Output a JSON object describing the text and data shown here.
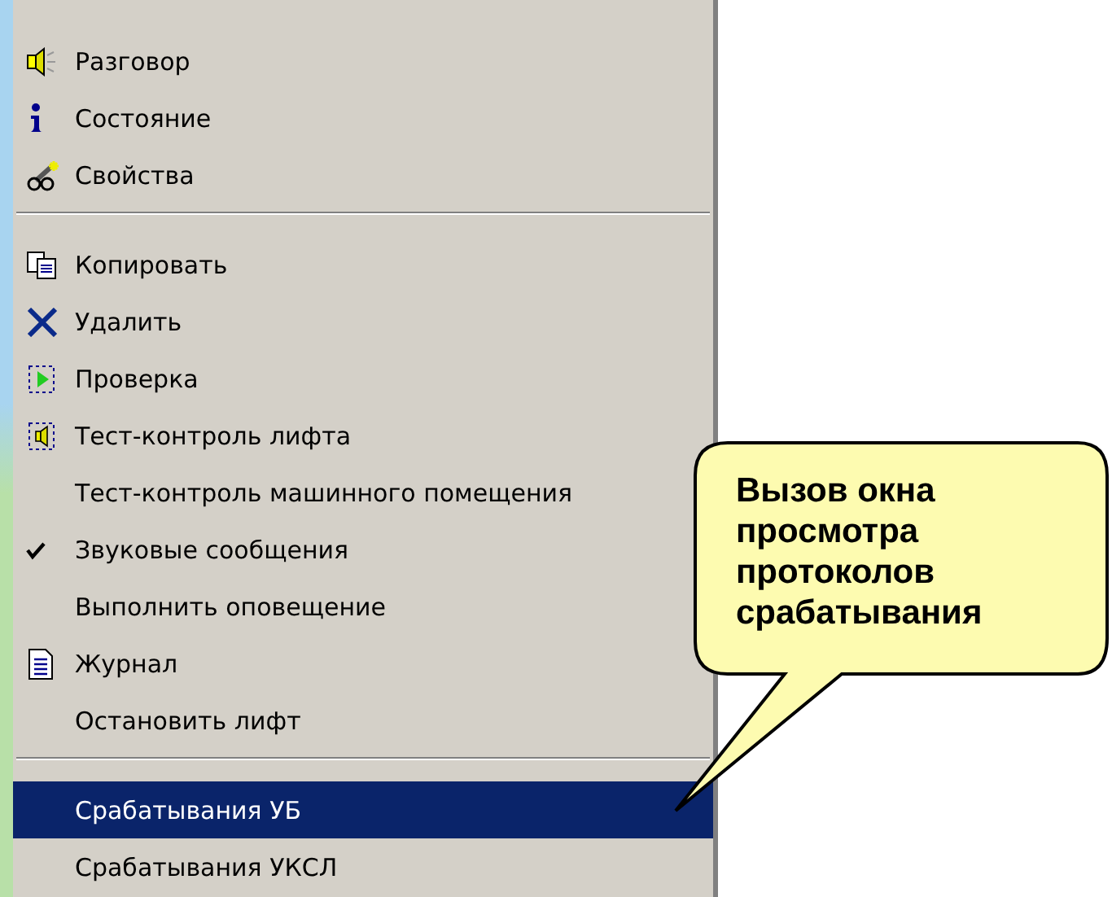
{
  "menu": {
    "items": [
      {
        "kind": "item",
        "label": "Разговор",
        "checked": false,
        "selected": false
      },
      {
        "kind": "item",
        "label": "Состояние",
        "checked": false,
        "selected": false
      },
      {
        "kind": "item",
        "label": "Свойства",
        "checked": false,
        "selected": false
      },
      {
        "kind": "separator"
      },
      {
        "kind": "item",
        "label": "Копировать",
        "checked": false,
        "selected": false
      },
      {
        "kind": "item",
        "label": "Удалить",
        "checked": false,
        "selected": false
      },
      {
        "kind": "item",
        "label": "Проверка",
        "checked": false,
        "selected": false
      },
      {
        "kind": "item",
        "label": "Тест-контроль лифта",
        "checked": false,
        "selected": false
      },
      {
        "kind": "item",
        "label": "Тест-контроль машинного помещения",
        "checked": false,
        "selected": false
      },
      {
        "kind": "item",
        "label": "Звуковые сообщения",
        "checked": true,
        "selected": false
      },
      {
        "kind": "item",
        "label": "Выполнить оповещение",
        "checked": false,
        "selected": false
      },
      {
        "kind": "item",
        "label": "Журнал",
        "checked": false,
        "selected": false
      },
      {
        "kind": "item",
        "label": "Остановить лифт",
        "checked": false,
        "selected": false
      },
      {
        "kind": "separator"
      },
      {
        "kind": "item",
        "label": "Срабатывания УБ",
        "checked": false,
        "selected": true
      },
      {
        "kind": "item",
        "label": "Срабатывания УКСЛ",
        "checked": false,
        "selected": false
      }
    ]
  },
  "callout": {
    "text": "Вызов окна просмотра протоколов срабатывания"
  }
}
